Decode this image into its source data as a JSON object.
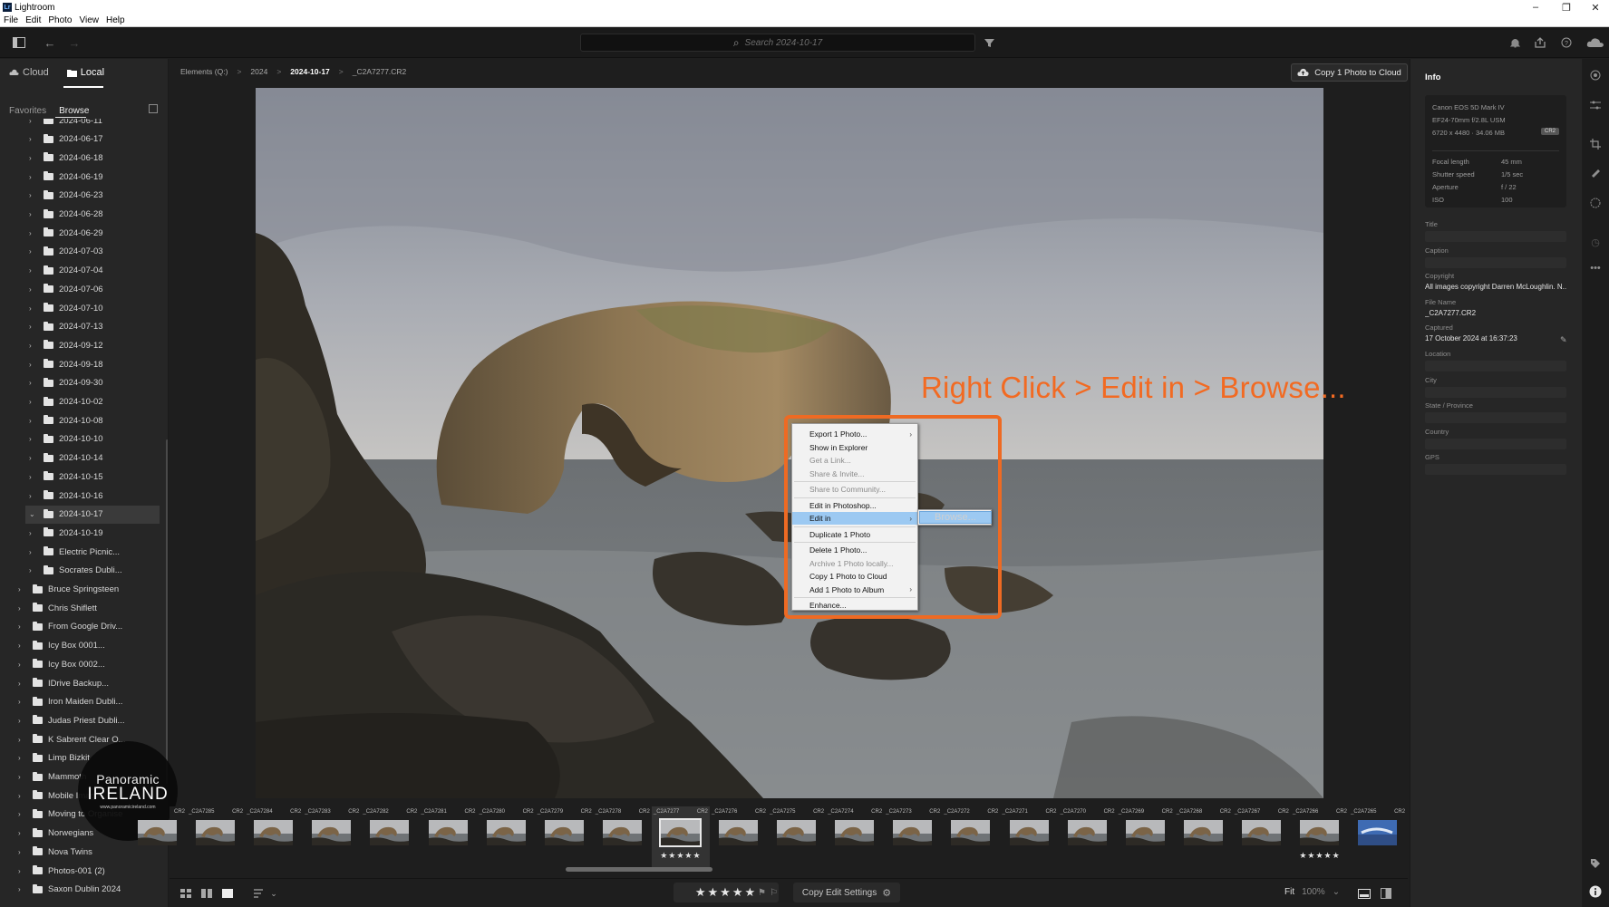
{
  "window": {
    "title": "Lightroom",
    "minimize": "–",
    "restore": "❐",
    "close": "✕"
  },
  "menu": [
    "File",
    "Edit",
    "Photo",
    "View",
    "Help"
  ],
  "toolbar": {
    "search_placeholder": "Search 2024-10-17"
  },
  "left_panel": {
    "tabs": [
      {
        "label": "Cloud",
        "active": false
      },
      {
        "label": "Local",
        "active": true
      }
    ],
    "subtabs": [
      {
        "label": "Favorites",
        "active": false
      },
      {
        "label": "Browse",
        "active": true
      }
    ],
    "tree": [
      {
        "label": "2024-06-11",
        "depth": 1,
        "selected": false
      },
      {
        "label": "2024-06-17",
        "depth": 1,
        "selected": false
      },
      {
        "label": "2024-06-18",
        "depth": 1,
        "selected": false
      },
      {
        "label": "2024-06-19",
        "depth": 1,
        "selected": false
      },
      {
        "label": "2024-06-23",
        "depth": 1,
        "selected": false
      },
      {
        "label": "2024-06-28",
        "depth": 1,
        "selected": false
      },
      {
        "label": "2024-06-29",
        "depth": 1,
        "selected": false
      },
      {
        "label": "2024-07-03",
        "depth": 1,
        "selected": false
      },
      {
        "label": "2024-07-04",
        "depth": 1,
        "selected": false
      },
      {
        "label": "2024-07-06",
        "depth": 1,
        "selected": false
      },
      {
        "label": "2024-07-10",
        "depth": 1,
        "selected": false
      },
      {
        "label": "2024-07-13",
        "depth": 1,
        "selected": false
      },
      {
        "label": "2024-09-12",
        "depth": 1,
        "selected": false
      },
      {
        "label": "2024-09-18",
        "depth": 1,
        "selected": false
      },
      {
        "label": "2024-09-30",
        "depth": 1,
        "selected": false
      },
      {
        "label": "2024-10-02",
        "depth": 1,
        "selected": false
      },
      {
        "label": "2024-10-08",
        "depth": 1,
        "selected": false
      },
      {
        "label": "2024-10-10",
        "depth": 1,
        "selected": false
      },
      {
        "label": "2024-10-14",
        "depth": 1,
        "selected": false
      },
      {
        "label": "2024-10-15",
        "depth": 1,
        "selected": false
      },
      {
        "label": "2024-10-16",
        "depth": 1,
        "selected": false
      },
      {
        "label": "2024-10-17",
        "depth": 1,
        "selected": true
      },
      {
        "label": "2024-10-19",
        "depth": 1,
        "selected": false
      },
      {
        "label": "Electric Picnic...",
        "depth": 1,
        "selected": false
      },
      {
        "label": "Socrates Dubli...",
        "depth": 1,
        "selected": false
      },
      {
        "label": "Bruce Springsteen",
        "depth": 0,
        "selected": false
      },
      {
        "label": "Chris Shiflett",
        "depth": 0,
        "selected": false
      },
      {
        "label": "From Google Driv...",
        "depth": 0,
        "selected": false
      },
      {
        "label": "Icy Box 0001...",
        "depth": 0,
        "selected": false
      },
      {
        "label": "Icy Box 0002...",
        "depth": 0,
        "selected": false
      },
      {
        "label": "IDrive Backup...",
        "depth": 0,
        "selected": false
      },
      {
        "label": "Iron Maiden Dubli...",
        "depth": 0,
        "selected": false
      },
      {
        "label": "Judas Priest Dubli...",
        "depth": 0,
        "selected": false
      },
      {
        "label": "K Sabrent Clear O...",
        "depth": 0,
        "selected": false
      },
      {
        "label": "Limp Bizkit",
        "depth": 0,
        "selected": false
      },
      {
        "label": "Mammoth",
        "depth": 0,
        "selected": false
      },
      {
        "label": "Mobile Image...",
        "depth": 0,
        "selected": false
      },
      {
        "label": "Moving to Organise",
        "depth": 0,
        "selected": false
      },
      {
        "label": "Norwegians",
        "depth": 0,
        "selected": false
      },
      {
        "label": "Nova Twins",
        "depth": 0,
        "selected": false
      },
      {
        "label": "Photos-001 (2)",
        "depth": 0,
        "selected": false
      },
      {
        "label": "Saxon Dublin 2024",
        "depth": 0,
        "selected": false
      }
    ]
  },
  "watermark": {
    "line1": "Panoramic",
    "line2": "IRELAND",
    "url": "www.panoramicireland.com"
  },
  "breadcrumb": {
    "items": [
      "Elements (Q:)",
      "2024",
      "2024-10-17",
      "_C2A7277.CR2"
    ],
    "separator": ">"
  },
  "copy_button": {
    "label": "Copy 1 Photo to Cloud"
  },
  "annotation": {
    "text": "Right Click > Edit in > Browse..."
  },
  "context_menu": {
    "items": [
      {
        "label": "Export 1 Photo...",
        "enabled": true,
        "submenu": true,
        "highlight": false
      },
      {
        "label": "Show in Explorer",
        "enabled": true,
        "submenu": false,
        "highlight": false
      },
      {
        "label": "Get a Link...",
        "enabled": false,
        "submenu": false,
        "highlight": false
      },
      {
        "label": "Share & Invite...",
        "enabled": false,
        "submenu": false,
        "highlight": false,
        "sep_after": true
      },
      {
        "label": "Share to Community...",
        "enabled": false,
        "submenu": false,
        "highlight": false,
        "sep_after": true
      },
      {
        "label": "Edit in Photoshop...",
        "enabled": true,
        "submenu": false,
        "highlight": false
      },
      {
        "label": "Edit in",
        "enabled": true,
        "submenu": true,
        "highlight": true,
        "sep_after": true
      },
      {
        "label": "Duplicate 1 Photo",
        "enabled": true,
        "submenu": false,
        "highlight": false,
        "sep_after": true
      },
      {
        "label": "Delete 1 Photo...",
        "enabled": true,
        "submenu": false,
        "highlight": false
      },
      {
        "label": "Archive 1 Photo locally...",
        "enabled": false,
        "submenu": false,
        "highlight": false
      },
      {
        "label": "Copy 1 Photo to Cloud",
        "enabled": true,
        "submenu": false,
        "highlight": false
      },
      {
        "label": "Add 1 Photo to Album",
        "enabled": true,
        "submenu": true,
        "highlight": false,
        "sep_after": true
      },
      {
        "label": "Enhance...",
        "enabled": true,
        "submenu": false,
        "highlight": false
      }
    ],
    "submenu_item": "Browse..."
  },
  "filmstrip": {
    "thumbnails": [
      {
        "name": "",
        "ext": "CR2",
        "stars": ""
      },
      {
        "name": "_C2A7285",
        "ext": "CR2",
        "stars": ""
      },
      {
        "name": "_C2A7284",
        "ext": "CR2",
        "stars": ""
      },
      {
        "name": "_C2A7283",
        "ext": "CR2",
        "stars": ""
      },
      {
        "name": "_C2A7282",
        "ext": "CR2",
        "stars": ""
      },
      {
        "name": "_C2A7281",
        "ext": "CR2",
        "stars": ""
      },
      {
        "name": "_C2A7280",
        "ext": "CR2",
        "stars": ""
      },
      {
        "name": "_C2A7279",
        "ext": "CR2",
        "stars": ""
      },
      {
        "name": "_C2A7278",
        "ext": "CR2",
        "stars": ""
      },
      {
        "name": "_C2A7277",
        "ext": "CR2",
        "stars": "★★★★★",
        "selected": true
      },
      {
        "name": "_C2A7276",
        "ext": "CR2",
        "stars": ""
      },
      {
        "name": "_C2A7275",
        "ext": "CR2",
        "stars": ""
      },
      {
        "name": "_C2A7274",
        "ext": "CR2",
        "stars": ""
      },
      {
        "name": "_C2A7273",
        "ext": "CR2",
        "stars": ""
      },
      {
        "name": "_C2A7272",
        "ext": "CR2",
        "stars": ""
      },
      {
        "name": "_C2A7271",
        "ext": "CR2",
        "stars": ""
      },
      {
        "name": "_C2A7270",
        "ext": "CR2",
        "stars": ""
      },
      {
        "name": "_C2A7269",
        "ext": "CR2",
        "stars": ""
      },
      {
        "name": "_C2A7268",
        "ext": "CR2",
        "stars": ""
      },
      {
        "name": "_C2A7267",
        "ext": "CR2",
        "stars": ""
      },
      {
        "name": "_C2A7266",
        "ext": "CR2",
        "stars": "★★★★★"
      },
      {
        "name": "_C2A7265",
        "ext": "CR2",
        "stars": ""
      }
    ]
  },
  "bottom_bar": {
    "rating": "★★★★★",
    "copy_edit": "Copy Edit Settings",
    "fit": "Fit",
    "zoom": "100%"
  },
  "info_panel": {
    "heading": "Info",
    "camera": "Canon EOS 5D Mark IV",
    "lens": "EF24-70mm f/2.8L USM",
    "dimensions": "6720 x 4480  ·  34.06 MB",
    "badge": "CR2",
    "exif": [
      {
        "label": "Focal length",
        "value": "45 mm"
      },
      {
        "label": "Shutter speed",
        "value": "1/5 sec"
      },
      {
        "label": "Aperture",
        "value": "f / 22"
      },
      {
        "label": "ISO",
        "value": "100"
      }
    ],
    "fields": [
      {
        "label": "Title",
        "value": ""
      },
      {
        "label": "Caption",
        "value": ""
      },
      {
        "label": "Copyright",
        "value": "All images copyright Darren McLoughlin. N..."
      },
      {
        "label": "File Name",
        "value": "_C2A7277.CR2"
      },
      {
        "label": "Captured",
        "value": "17 October 2024 at 16:37:23"
      },
      {
        "label": "Location",
        "value": ""
      },
      {
        "label": "City",
        "value": ""
      },
      {
        "label": "State / Province",
        "value": ""
      },
      {
        "label": "Country",
        "value": ""
      },
      {
        "label": "GPS",
        "value": ""
      }
    ]
  },
  "colors": {
    "accent": "#ee6a23",
    "menu_highlight": "#9cc9f2",
    "background": "#1e1e1e"
  }
}
